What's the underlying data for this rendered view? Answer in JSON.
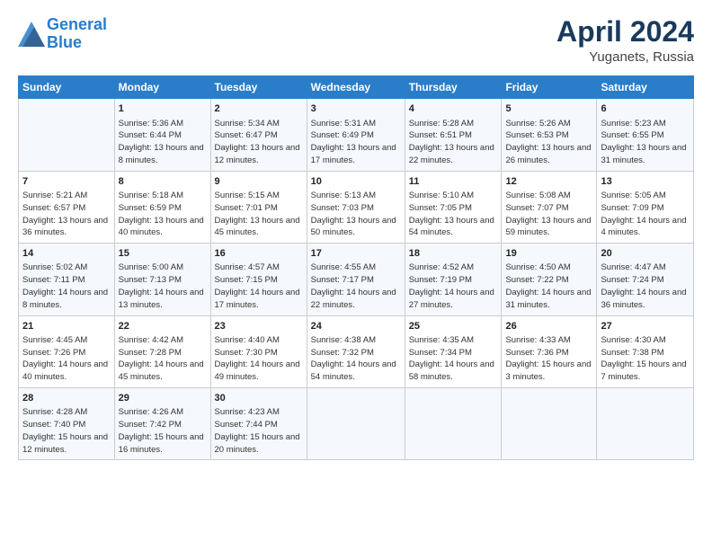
{
  "header": {
    "logo_line1": "General",
    "logo_line2": "Blue",
    "month": "April 2024",
    "location": "Yuganets, Russia"
  },
  "weekdays": [
    "Sunday",
    "Monday",
    "Tuesday",
    "Wednesday",
    "Thursday",
    "Friday",
    "Saturday"
  ],
  "weeks": [
    [
      {
        "day": "",
        "info": ""
      },
      {
        "day": "1",
        "info": "Sunrise: 5:36 AM\nSunset: 6:44 PM\nDaylight: 13 hours\nand 8 minutes."
      },
      {
        "day": "2",
        "info": "Sunrise: 5:34 AM\nSunset: 6:47 PM\nDaylight: 13 hours\nand 12 minutes."
      },
      {
        "day": "3",
        "info": "Sunrise: 5:31 AM\nSunset: 6:49 PM\nDaylight: 13 hours\nand 17 minutes."
      },
      {
        "day": "4",
        "info": "Sunrise: 5:28 AM\nSunset: 6:51 PM\nDaylight: 13 hours\nand 22 minutes."
      },
      {
        "day": "5",
        "info": "Sunrise: 5:26 AM\nSunset: 6:53 PM\nDaylight: 13 hours\nand 26 minutes."
      },
      {
        "day": "6",
        "info": "Sunrise: 5:23 AM\nSunset: 6:55 PM\nDaylight: 13 hours\nand 31 minutes."
      }
    ],
    [
      {
        "day": "7",
        "info": "Sunrise: 5:21 AM\nSunset: 6:57 PM\nDaylight: 13 hours\nand 36 minutes."
      },
      {
        "day": "8",
        "info": "Sunrise: 5:18 AM\nSunset: 6:59 PM\nDaylight: 13 hours\nand 40 minutes."
      },
      {
        "day": "9",
        "info": "Sunrise: 5:15 AM\nSunset: 7:01 PM\nDaylight: 13 hours\nand 45 minutes."
      },
      {
        "day": "10",
        "info": "Sunrise: 5:13 AM\nSunset: 7:03 PM\nDaylight: 13 hours\nand 50 minutes."
      },
      {
        "day": "11",
        "info": "Sunrise: 5:10 AM\nSunset: 7:05 PM\nDaylight: 13 hours\nand 54 minutes."
      },
      {
        "day": "12",
        "info": "Sunrise: 5:08 AM\nSunset: 7:07 PM\nDaylight: 13 hours\nand 59 minutes."
      },
      {
        "day": "13",
        "info": "Sunrise: 5:05 AM\nSunset: 7:09 PM\nDaylight: 14 hours\nand 4 minutes."
      }
    ],
    [
      {
        "day": "14",
        "info": "Sunrise: 5:02 AM\nSunset: 7:11 PM\nDaylight: 14 hours\nand 8 minutes."
      },
      {
        "day": "15",
        "info": "Sunrise: 5:00 AM\nSunset: 7:13 PM\nDaylight: 14 hours\nand 13 minutes."
      },
      {
        "day": "16",
        "info": "Sunrise: 4:57 AM\nSunset: 7:15 PM\nDaylight: 14 hours\nand 17 minutes."
      },
      {
        "day": "17",
        "info": "Sunrise: 4:55 AM\nSunset: 7:17 PM\nDaylight: 14 hours\nand 22 minutes."
      },
      {
        "day": "18",
        "info": "Sunrise: 4:52 AM\nSunset: 7:19 PM\nDaylight: 14 hours\nand 27 minutes."
      },
      {
        "day": "19",
        "info": "Sunrise: 4:50 AM\nSunset: 7:22 PM\nDaylight: 14 hours\nand 31 minutes."
      },
      {
        "day": "20",
        "info": "Sunrise: 4:47 AM\nSunset: 7:24 PM\nDaylight: 14 hours\nand 36 minutes."
      }
    ],
    [
      {
        "day": "21",
        "info": "Sunrise: 4:45 AM\nSunset: 7:26 PM\nDaylight: 14 hours\nand 40 minutes."
      },
      {
        "day": "22",
        "info": "Sunrise: 4:42 AM\nSunset: 7:28 PM\nDaylight: 14 hours\nand 45 minutes."
      },
      {
        "day": "23",
        "info": "Sunrise: 4:40 AM\nSunset: 7:30 PM\nDaylight: 14 hours\nand 49 minutes."
      },
      {
        "day": "24",
        "info": "Sunrise: 4:38 AM\nSunset: 7:32 PM\nDaylight: 14 hours\nand 54 minutes."
      },
      {
        "day": "25",
        "info": "Sunrise: 4:35 AM\nSunset: 7:34 PM\nDaylight: 14 hours\nand 58 minutes."
      },
      {
        "day": "26",
        "info": "Sunrise: 4:33 AM\nSunset: 7:36 PM\nDaylight: 15 hours\nand 3 minutes."
      },
      {
        "day": "27",
        "info": "Sunrise: 4:30 AM\nSunset: 7:38 PM\nDaylight: 15 hours\nand 7 minutes."
      }
    ],
    [
      {
        "day": "28",
        "info": "Sunrise: 4:28 AM\nSunset: 7:40 PM\nDaylight: 15 hours\nand 12 minutes."
      },
      {
        "day": "29",
        "info": "Sunrise: 4:26 AM\nSunset: 7:42 PM\nDaylight: 15 hours\nand 16 minutes."
      },
      {
        "day": "30",
        "info": "Sunrise: 4:23 AM\nSunset: 7:44 PM\nDaylight: 15 hours\nand 20 minutes."
      },
      {
        "day": "",
        "info": ""
      },
      {
        "day": "",
        "info": ""
      },
      {
        "day": "",
        "info": ""
      },
      {
        "day": "",
        "info": ""
      }
    ]
  ]
}
